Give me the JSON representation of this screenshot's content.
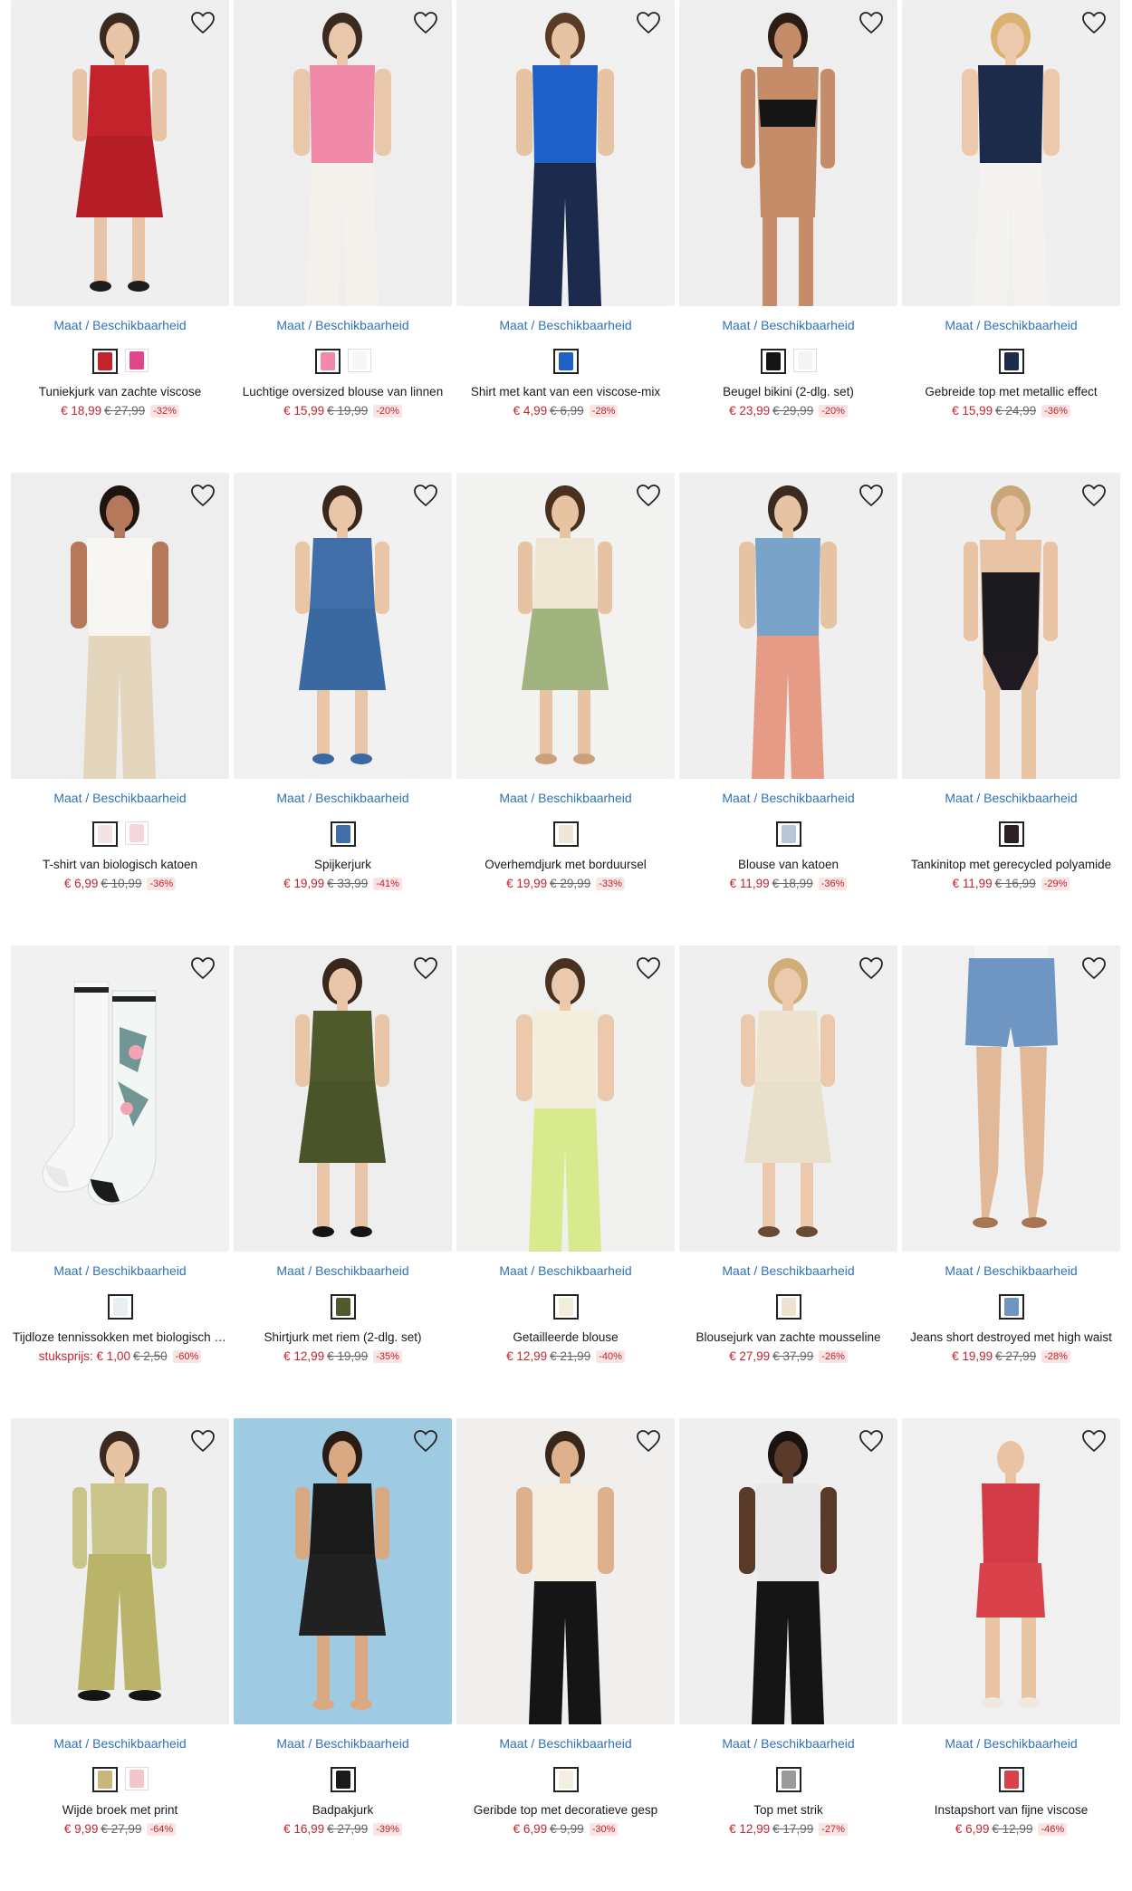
{
  "labels": {
    "maat": "Maat / Beschikbaarheid"
  },
  "colors": {
    "accent_link": "#2f73b7",
    "price_sale": "#c0262d",
    "discount_bg": "#fbe4e4"
  },
  "products": [
    {
      "name": "Tuniekjurk van zachte viscose",
      "price": "€ 18,99",
      "old_price": "€ 27,99",
      "discount": "-32%",
      "bg": "#efefef",
      "top": "#c3232b",
      "bottom": "#b51f27",
      "skin": "#e7c4a5",
      "hair": "#3b2a20",
      "shoe": "#1d1d1d",
      "style": "dress",
      "swatches": [
        "#c3232b",
        "#e0478b"
      ]
    },
    {
      "name": "Luchtige oversized blouse van linnen",
      "price": "€ 15,99",
      "old_price": "€ 19,99",
      "discount": "-20%",
      "bg": "#eeeeee",
      "top": "#f08aa8",
      "bottom": "#f4f1ec",
      "skin": "#e8c7aa",
      "hair": "#3a2a1f",
      "shoe": "#e8e0d6",
      "style": "top",
      "swatches": [
        "#f08aa8",
        "#f7f7f7"
      ]
    },
    {
      "name": "Shirt met kant van een viscose-mix",
      "price": "€ 4,99",
      "old_price": "€ 6,99",
      "discount": "-28%",
      "bg": "#f0f0f0",
      "top": "#1f5fc8",
      "bottom": "#1c2a4d",
      "skin": "#e6c3a3",
      "hair": "#5a3b26",
      "shoe": "#1c2a4d",
      "style": "top",
      "swatches": [
        "#1f5fc8"
      ]
    },
    {
      "name": "Beugel bikini (2-dlg. set)",
      "price": "€ 23,99",
      "old_price": "€ 29,99",
      "discount": "-20%",
      "bg": "#eeeeee",
      "top": "#151515",
      "bottom": "#c48c68",
      "skin": "#c48c68",
      "hair": "#2b1c14",
      "shoe": "#c48c68",
      "style": "bikini",
      "swatches": [
        "#151515",
        "#f4f4f4"
      ]
    },
    {
      "name": "Gebreide top met metallic effect",
      "price": "€ 15,99",
      "old_price": "€ 24,99",
      "discount": "-36%",
      "bg": "#efefef",
      "top": "#1d2b4a",
      "bottom": "#f5f3ef",
      "skin": "#ecc9ad",
      "hair": "#d9b26f",
      "shoe": "#f5f3ef",
      "style": "top",
      "swatches": [
        "#1d2b4a"
      ]
    },
    {
      "name": "T-shirt van biologisch katoen",
      "price": "€ 6,99",
      "old_price": "€ 10,99",
      "discount": "-36%",
      "bg": "#eeeeee",
      "top": "#f8f6f3",
      "bottom": "#e4d6bd",
      "skin": "#b5785a",
      "hair": "#1e1410",
      "shoe": "#e4d6bd",
      "style": "top",
      "swatches": [
        "#f3e4e4",
        "#f4d6dd"
      ]
    },
    {
      "name": "Spijkerjurk",
      "price": "€ 19,99",
      "old_price": "€ 33,99",
      "discount": "-41%",
      "bg": "#f1f1f1",
      "top": "#3f6ea8",
      "bottom": "#3a68a0",
      "skin": "#e9c6a8",
      "hair": "#3a271c",
      "shoe": "#3a68a0",
      "style": "dress",
      "swatches": [
        "#3f6ea8"
      ]
    },
    {
      "name": "Overhemdjurk met borduursel",
      "price": "€ 19,99",
      "old_price": "€ 29,99",
      "discount": "-33%",
      "bg": "#f2f2f0",
      "top": "#efe6d3",
      "bottom": "#9cb07a",
      "skin": "#e6c3a3",
      "hair": "#4a3021",
      "shoe": "#caa27a",
      "style": "dress",
      "swatches": [
        "#efe6d3"
      ]
    },
    {
      "name": "Blouse van katoen",
      "price": "€ 11,99",
      "old_price": "€ 18,99",
      "discount": "-36%",
      "bg": "#efefef",
      "top": "#7aa3c9",
      "bottom": "#e59b86",
      "skin": "#e6c3a3",
      "hair": "#3b2a20",
      "shoe": "#e59b86",
      "style": "top",
      "swatches": [
        "#b8c7d8"
      ]
    },
    {
      "name": "Tankinitop met gerecycled polyamide",
      "price": "€ 11,99",
      "old_price": "€ 16,99",
      "discount": "-29%",
      "bg": "#efefef",
      "top": "#1b1b1f",
      "bottom": "#201a22",
      "skin": "#e8c3a4",
      "hair": "#c9a77a",
      "shoe": "#e8c3a4",
      "style": "bikini",
      "swatches": [
        "#2b2026"
      ]
    },
    {
      "name": "Tijdloze tennissokken met biologisch katoen",
      "price": "€ 1,00",
      "price_prefix": "stuksprijs:",
      "old_price": "€ 2,50",
      "discount": "-60%",
      "bg": "#f1f1f1",
      "top": "#f7f7f7",
      "bottom": "#1b1b1b",
      "skin": "#f7f7f7",
      "hair": "#f1f1f1",
      "shoe": "#1b1b1b",
      "style": "socks",
      "swatches": [
        "#e9eef2"
      ]
    },
    {
      "name": "Shirtjurk met riem (2-dlg. set)",
      "price": "€ 12,99",
      "old_price": "€ 19,99",
      "discount": "-35%",
      "bg": "#eeeeee",
      "top": "#4f5a2c",
      "bottom": "#4a5429",
      "skin": "#e9c6a8",
      "hair": "#3a271c",
      "shoe": "#151515",
      "style": "dress",
      "swatches": [
        "#4f5a2c"
      ]
    },
    {
      "name": "Getailleerde blouse",
      "price": "€ 12,99",
      "old_price": "€ 21,99",
      "discount": "-40%",
      "bg": "#f0f0ef",
      "top": "#f2eddc",
      "bottom": "#d8ea8e",
      "skin": "#ecc9ad",
      "hair": "#4a3021",
      "shoe": "#d8ea8e",
      "style": "top",
      "swatches": [
        "#f2eddc"
      ]
    },
    {
      "name": "Blousejurk van zachte mousseline",
      "price": "€ 27,99",
      "old_price": "€ 37,99",
      "discount": "-26%",
      "bg": "#efefef",
      "top": "#ede3cf",
      "bottom": "#e9dfca",
      "skin": "#ecc9ad",
      "hair": "#cfae79",
      "shoe": "#6b4a33",
      "style": "dress",
      "swatches": [
        "#ede3cf"
      ]
    },
    {
      "name": "Jeans short destroyed met high waist",
      "price": "€ 19,99",
      "old_price": "€ 27,99",
      "discount": "-28%",
      "bg": "#f0f0f0",
      "top": "#f6f6f6",
      "bottom": "#6f95c2",
      "skin": "#e2b998",
      "hair": "#f0f0f0",
      "shoe": "#a87552",
      "style": "shorts",
      "swatches": [
        "#6f95c2"
      ]
    },
    {
      "name": "Wijde broek met print",
      "price": "€ 9,99",
      "old_price": "€ 27,99",
      "discount": "-64%",
      "bg": "#efefef",
      "top": "#c9c48a",
      "bottom": "#b9b46a",
      "skin": "#e6c3a3",
      "hair": "#3b2a20",
      "shoe": "#151515",
      "style": "pants",
      "swatches": [
        "#c9b67a",
        "#f0c6c9"
      ]
    },
    {
      "name": "Badpakjurk",
      "price": "€ 16,99",
      "old_price": "€ 27,99",
      "discount": "-39%",
      "bg": "#9fcbe2",
      "top": "#1a1a1a",
      "bottom": "#222222",
      "skin": "#d9a983",
      "hair": "#2a1c14",
      "shoe": "#d9a983",
      "style": "dress",
      "swatches": [
        "#1a1a1a"
      ]
    },
    {
      "name": "Geribde top met decoratieve gesp",
      "price": "€ 6,99",
      "old_price": "€ 9,99",
      "discount": "-30%",
      "bg": "#f0efee",
      "top": "#f4efe2",
      "bottom": "#151515",
      "skin": "#ddb18d",
      "hair": "#3a271c",
      "shoe": "#151515",
      "style": "top",
      "swatches": [
        "#f4efe2"
      ]
    },
    {
      "name": "Top met strik",
      "price": "€ 12,99",
      "old_price": "€ 17,99",
      "discount": "-27%",
      "bg": "#efefef",
      "top": "#e9e9e9",
      "bottom": "#151515",
      "skin": "#5a3a2a",
      "hair": "#1a1210",
      "shoe": "#151515",
      "style": "top",
      "swatches": [
        "#9a9a9a"
      ]
    },
    {
      "name": "Instapshort van fijne viscose",
      "price": "€ 6,99",
      "old_price": "€ 12,99",
      "discount": "-46%",
      "bg": "#f0f0f0",
      "top": "#d23b45",
      "bottom": "#d9414b",
      "skin": "#e8c3a4",
      "hair": "#f0f0f0",
      "shoe": "#efe7dc",
      "style": "shorts",
      "swatches": [
        "#d9414b"
      ]
    }
  ]
}
